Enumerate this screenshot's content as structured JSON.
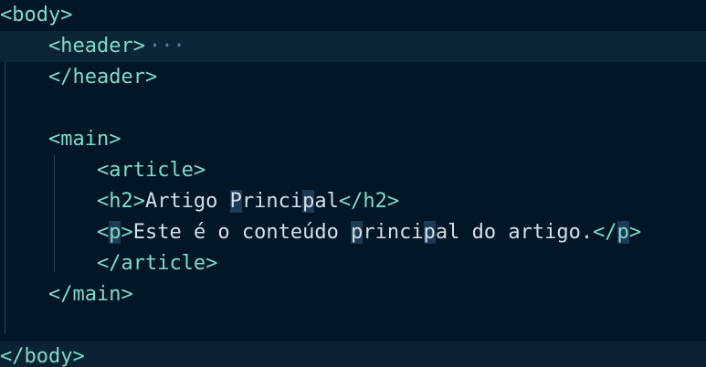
{
  "editor": {
    "lines": [
      {
        "indent": "",
        "segments": [
          {
            "t": "tag",
            "v": "<body>"
          }
        ]
      },
      {
        "indent": "    ",
        "segments": [
          {
            "t": "tag",
            "v": "<header>"
          },
          {
            "t": "fold",
            "v": "···"
          }
        ]
      },
      {
        "indent": "    ",
        "segments": [
          {
            "t": "tag",
            "v": "</header>"
          }
        ]
      },
      {
        "indent": "",
        "segments": []
      },
      {
        "indent": "    ",
        "segments": [
          {
            "t": "tag",
            "v": "<main>"
          }
        ]
      },
      {
        "indent": "        ",
        "segments": [
          {
            "t": "tag",
            "v": "<article>"
          }
        ]
      },
      {
        "indent": "        ",
        "segments": [
          {
            "t": "tag",
            "v": "<h2>"
          },
          {
            "t": "txt",
            "v": "Artigo "
          },
          {
            "t": "hl",
            "v": "P"
          },
          {
            "t": "txt",
            "v": "rinci"
          },
          {
            "t": "hl",
            "v": "p"
          },
          {
            "t": "txt",
            "v": "al"
          },
          {
            "t": "tag",
            "v": "</h2>"
          }
        ]
      },
      {
        "indent": "        ",
        "segments": [
          {
            "t": "tag",
            "v": "<"
          },
          {
            "t": "hltag",
            "v": "p"
          },
          {
            "t": "tag",
            "v": ">"
          },
          {
            "t": "txt",
            "v": "Este é o conteúdo "
          },
          {
            "t": "hl",
            "v": "p"
          },
          {
            "t": "txt",
            "v": "rinci"
          },
          {
            "t": "hl",
            "v": "p"
          },
          {
            "t": "txt",
            "v": "al do artigo."
          },
          {
            "t": "tag",
            "v": "</"
          },
          {
            "t": "hltag",
            "v": "p"
          },
          {
            "t": "tag",
            "v": ">"
          }
        ]
      },
      {
        "indent": "        ",
        "segments": [
          {
            "t": "tag",
            "v": "</article>"
          }
        ]
      },
      {
        "indent": "    ",
        "segments": [
          {
            "t": "tag",
            "v": "</main>"
          }
        ]
      },
      {
        "indent": "",
        "segments": []
      },
      {
        "indent": "",
        "segments": [
          {
            "t": "tag",
            "v": "</body>"
          }
        ]
      }
    ]
  },
  "colors": {
    "background": "#011627",
    "tag": "#7fdbca",
    "text": "#d6deeb",
    "highlight": "#1d3b53",
    "fold": "#5f7e97"
  },
  "icons": {
    "fold_icon": "ellipsis-fold-icon"
  }
}
